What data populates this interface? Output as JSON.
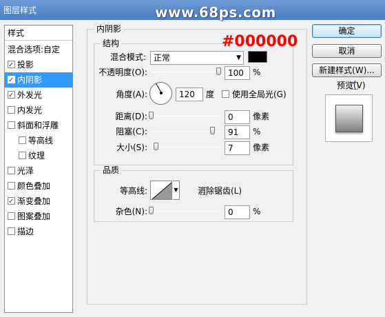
{
  "window": {
    "title": "图层样式",
    "watermark": "www.68ps.com"
  },
  "style_list": {
    "header": "样式",
    "items": [
      {
        "label": "混合选项:自定",
        "checkbox": false,
        "checked": false,
        "indent": false,
        "selected": false
      },
      {
        "label": "投影",
        "checkbox": true,
        "checked": true,
        "indent": false,
        "selected": false
      },
      {
        "label": "内阴影",
        "checkbox": true,
        "checked": true,
        "indent": false,
        "selected": true
      },
      {
        "label": "外发光",
        "checkbox": true,
        "checked": true,
        "indent": false,
        "selected": false
      },
      {
        "label": "内发光",
        "checkbox": true,
        "checked": false,
        "indent": false,
        "selected": false
      },
      {
        "label": "斜面和浮雕",
        "checkbox": true,
        "checked": false,
        "indent": false,
        "selected": false
      },
      {
        "label": "等高线",
        "checkbox": true,
        "checked": false,
        "indent": true,
        "selected": false
      },
      {
        "label": "纹理",
        "checkbox": true,
        "checked": false,
        "indent": true,
        "selected": false
      },
      {
        "label": "光泽",
        "checkbox": true,
        "checked": false,
        "indent": false,
        "selected": false
      },
      {
        "label": "颜色叠加",
        "checkbox": true,
        "checked": false,
        "indent": false,
        "selected": false
      },
      {
        "label": "渐变叠加",
        "checkbox": true,
        "checked": true,
        "indent": false,
        "selected": false
      },
      {
        "label": "图案叠加",
        "checkbox": true,
        "checked": false,
        "indent": false,
        "selected": false
      },
      {
        "label": "描边",
        "checkbox": true,
        "checked": false,
        "indent": false,
        "selected": false
      }
    ]
  },
  "inner_shadow": {
    "section_title": "内阴影",
    "structure": {
      "title": "结构",
      "blend_mode_label": "混合模式:",
      "blend_mode_value": "正常",
      "color_hex": "#000000",
      "color_note": "#000000",
      "opacity_label": "不透明度(O):",
      "opacity_value": "100",
      "opacity_unit": "%",
      "angle_label": "角度(A):",
      "angle_value": "120",
      "angle_unit": "度",
      "global_light_label": "使用全局光(G)",
      "global_light_checked": false,
      "distance_label": "距离(D):",
      "distance_value": "0",
      "distance_unit": "像素",
      "choke_label": "阻塞(C):",
      "choke_value": "91",
      "choke_unit": "%",
      "size_label": "大小(S):",
      "size_value": "7",
      "size_unit": "像素"
    },
    "quality": {
      "title": "品质",
      "contour_label": "等高线:",
      "antialias_label": "消除锯齿(L)",
      "antialias_checked": false,
      "noise_label": "杂色(N):",
      "noise_value": "0",
      "noise_unit": "%"
    }
  },
  "buttons": {
    "ok": "确定",
    "cancel": "取消",
    "new_style": "新建样式(W)...",
    "preview_label": "预览(V)",
    "preview_checked": true
  }
}
